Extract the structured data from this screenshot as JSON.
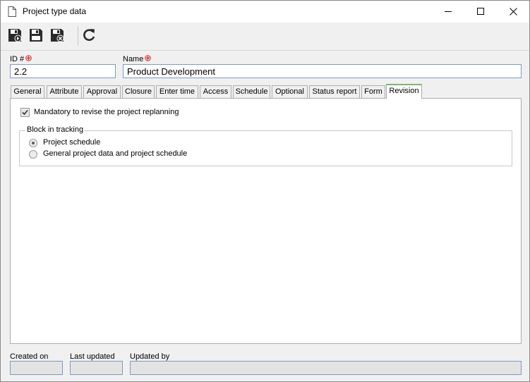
{
  "window": {
    "title": "Project type data",
    "icons": [
      "document-icon",
      "minimize-icon",
      "maximize-icon",
      "close-icon"
    ]
  },
  "toolbar": {
    "buttons": [
      {
        "name": "save-new-button",
        "icon": "save-new-icon"
      },
      {
        "name": "save-button",
        "icon": "save-icon"
      },
      {
        "name": "save-close-button",
        "icon": "save-close-icon"
      },
      {
        "name": "refresh-button",
        "icon": "refresh-icon"
      }
    ]
  },
  "form": {
    "id_label": "ID #",
    "id_value": "2.2",
    "name_label": "Name",
    "name_value": "Product Development",
    "required_color": "#d9302c"
  },
  "tabs": [
    {
      "label": "General"
    },
    {
      "label": "Attribute"
    },
    {
      "label": "Approval"
    },
    {
      "label": "Closure"
    },
    {
      "label": "Enter time"
    },
    {
      "label": "Access"
    },
    {
      "label": "Schedule"
    },
    {
      "label": "Optional"
    },
    {
      "label": "Status report"
    },
    {
      "label": "Form"
    },
    {
      "label": "Revision",
      "active": true
    }
  ],
  "revision": {
    "mandatory_label": "Mandatory to revise the project replanning",
    "mandatory_checked": true,
    "block_group_title": "Block in tracking",
    "options": [
      {
        "label": "Project schedule",
        "selected": true
      },
      {
        "label": "General project data and project schedule",
        "selected": false
      }
    ]
  },
  "footer": {
    "created_on_label": "Created on",
    "created_on_value": "",
    "last_updated_label": "Last updated",
    "last_updated_value": "",
    "updated_by_label": "Updated by",
    "updated_by_value": ""
  }
}
